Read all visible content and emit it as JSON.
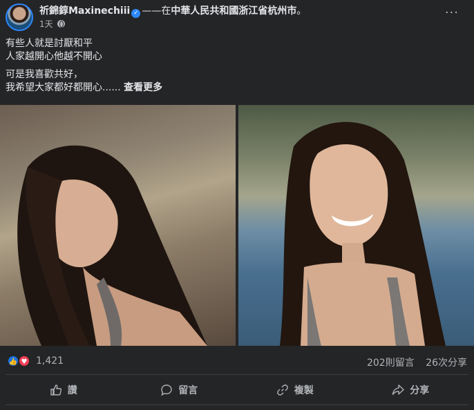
{
  "post": {
    "author": "祈錦錞Maxinechiii",
    "location_prefix": "——在",
    "location": "中華人民共和國浙江省杭州市",
    "location_suffix": "。",
    "time": "1天",
    "more": "···",
    "text_lines": [
      "有些人就是討厭和平",
      "人家越開心他越不開心"
    ],
    "text_lines2": [
      "可是我喜歡共好，",
      "我希望大家都好都開心......"
    ],
    "see_more": "查看更多"
  },
  "stats": {
    "reactions_count": "1,421",
    "comments": "202則留言",
    "shares": "26次分享"
  },
  "actions": {
    "like": "讚",
    "comment": "留言",
    "copy": "複製",
    "share": "分享"
  },
  "colors": {
    "background": "#242526",
    "like": "#1b74e4",
    "love": "#f33e58",
    "verified": "#2d88ff"
  },
  "icons": [
    "verified-icon",
    "globe-icon",
    "more-icon",
    "like-reaction-icon",
    "love-reaction-icon",
    "like-icon",
    "comment-icon",
    "copy-icon",
    "share-icon"
  ]
}
